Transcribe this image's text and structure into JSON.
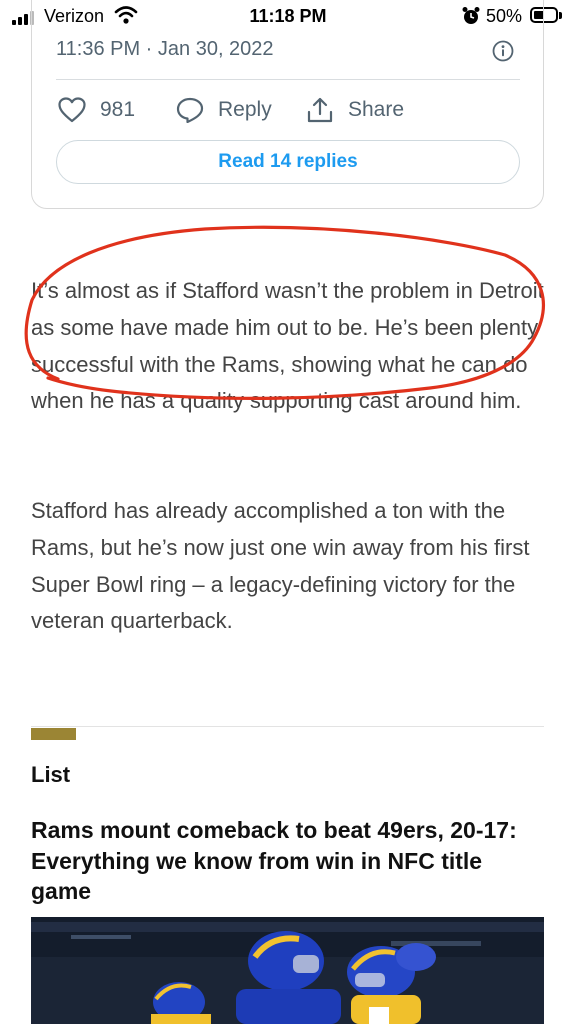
{
  "status_bar": {
    "carrier": "Verizon",
    "time": "11:18 PM",
    "battery": "50%",
    "battery_level": 0.5
  },
  "tweet": {
    "timestamp": "11:36 PM · Jan 30, 2022",
    "likes": "981",
    "reply_label": "Reply",
    "share_label": "Share",
    "read_replies": "Read 14 replies",
    "accent": "#1d9bf0"
  },
  "article": {
    "paragraphs": [
      "It’s almost as if Stafford wasn’t the problem in Detroit as some have made him out to be. He’s been plenty successful with the Rams, showing what he can do when he has a quality supporting cast around him.",
      "Stafford has already accomplished a ton with the Rams, but he’s now just one win away from his first Super Bowl ring – a legacy-defining victory for the veteran quarterback."
    ],
    "annotation_color": "#e0321c"
  },
  "list_section": {
    "label": "List",
    "accent": "#9b8534",
    "headline": "Rams mount comeback to beat 49ers, 20-17: Everything we know from win in NFC title game"
  }
}
